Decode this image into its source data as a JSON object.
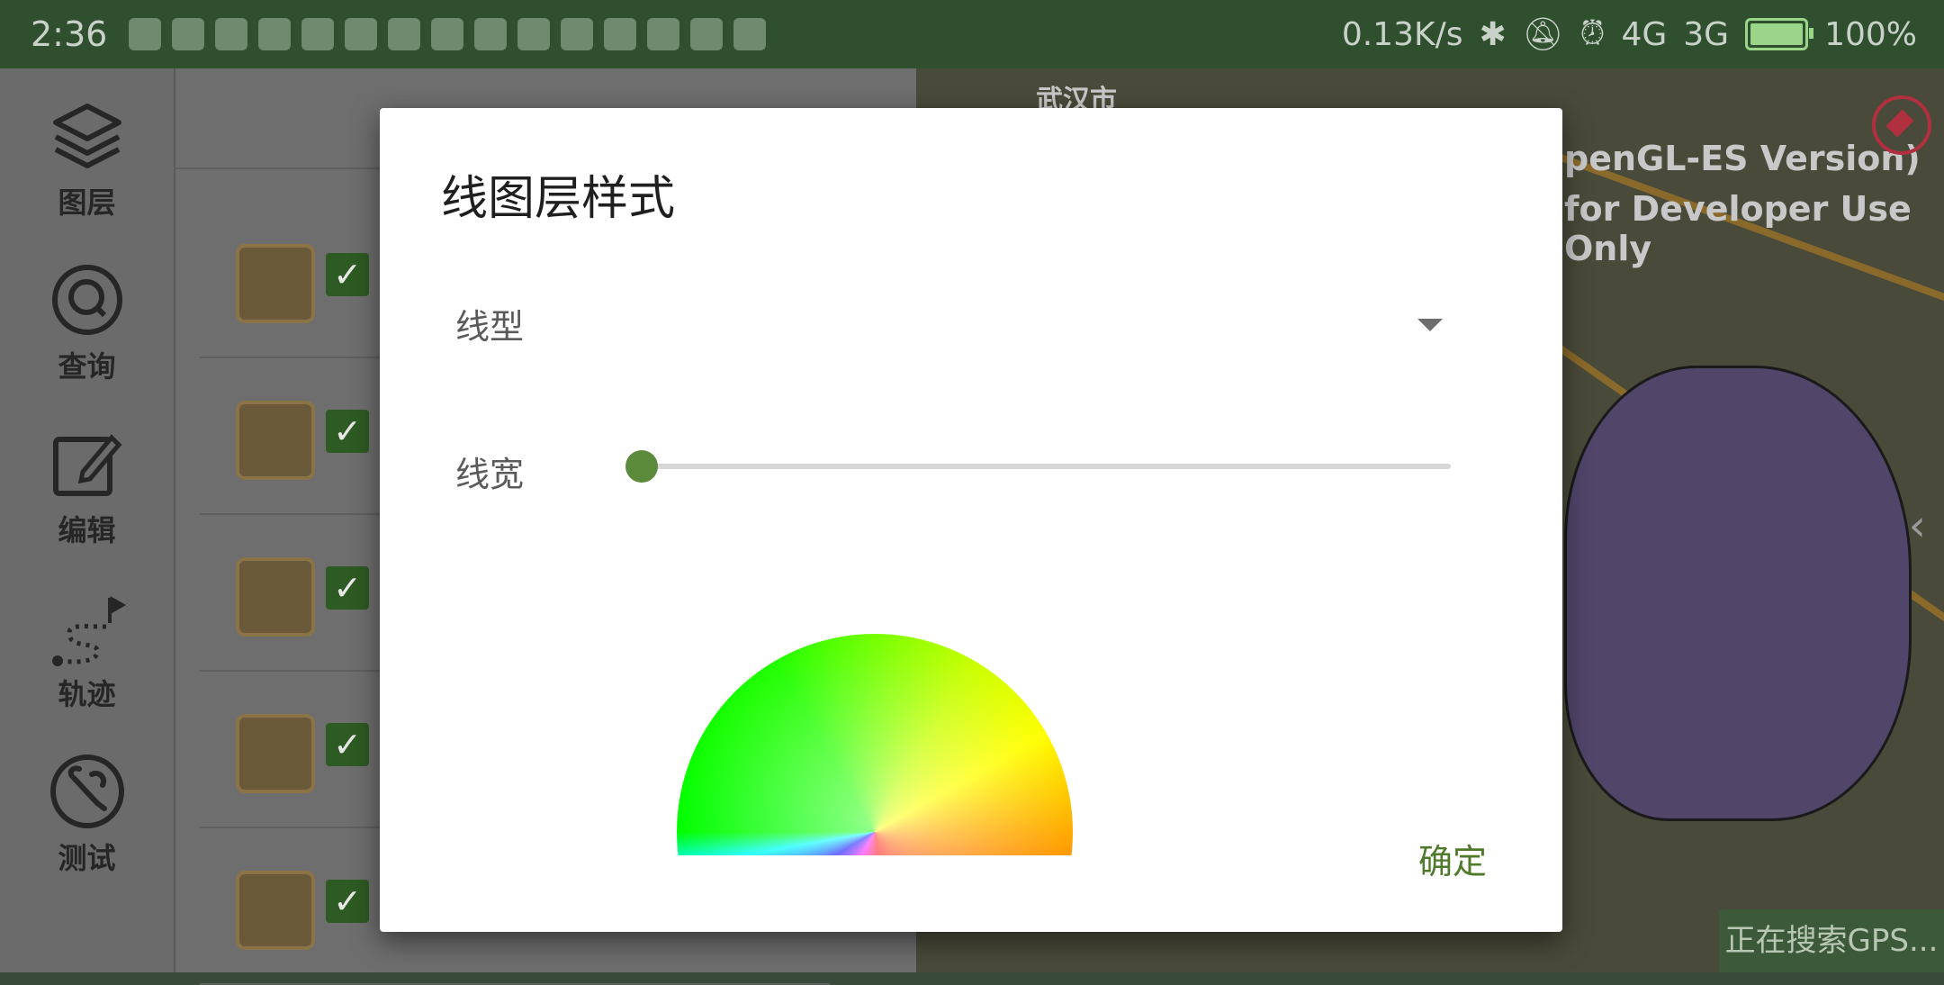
{
  "status_bar": {
    "time": "2:36",
    "network_speed": "0.13K/s",
    "signal_1": "4G",
    "signal_2": "3G",
    "battery": "100%"
  },
  "rail": {
    "items": [
      {
        "label": "图层",
        "icon": "layers-icon"
      },
      {
        "label": "查询",
        "icon": "search-icon"
      },
      {
        "label": "编辑",
        "icon": "edit-icon"
      },
      {
        "label": "轨迹",
        "icon": "route-icon"
      },
      {
        "label": "测试",
        "icon": "wrench-icon"
      }
    ]
  },
  "map": {
    "watermark_line1": "penGL-ES Version)",
    "watermark_line2": "for Developer Use Only",
    "city_label": "武汉市",
    "gps_status": "正在搜索GPS..."
  },
  "dialog": {
    "title": "线图层样式",
    "line_type_label": "线型",
    "line_width_label": "线宽",
    "line_width_value": 0,
    "confirm_label": "确定"
  },
  "colors": {
    "accent": "#5b8a3a",
    "statusbar": "#2f4f2f"
  }
}
